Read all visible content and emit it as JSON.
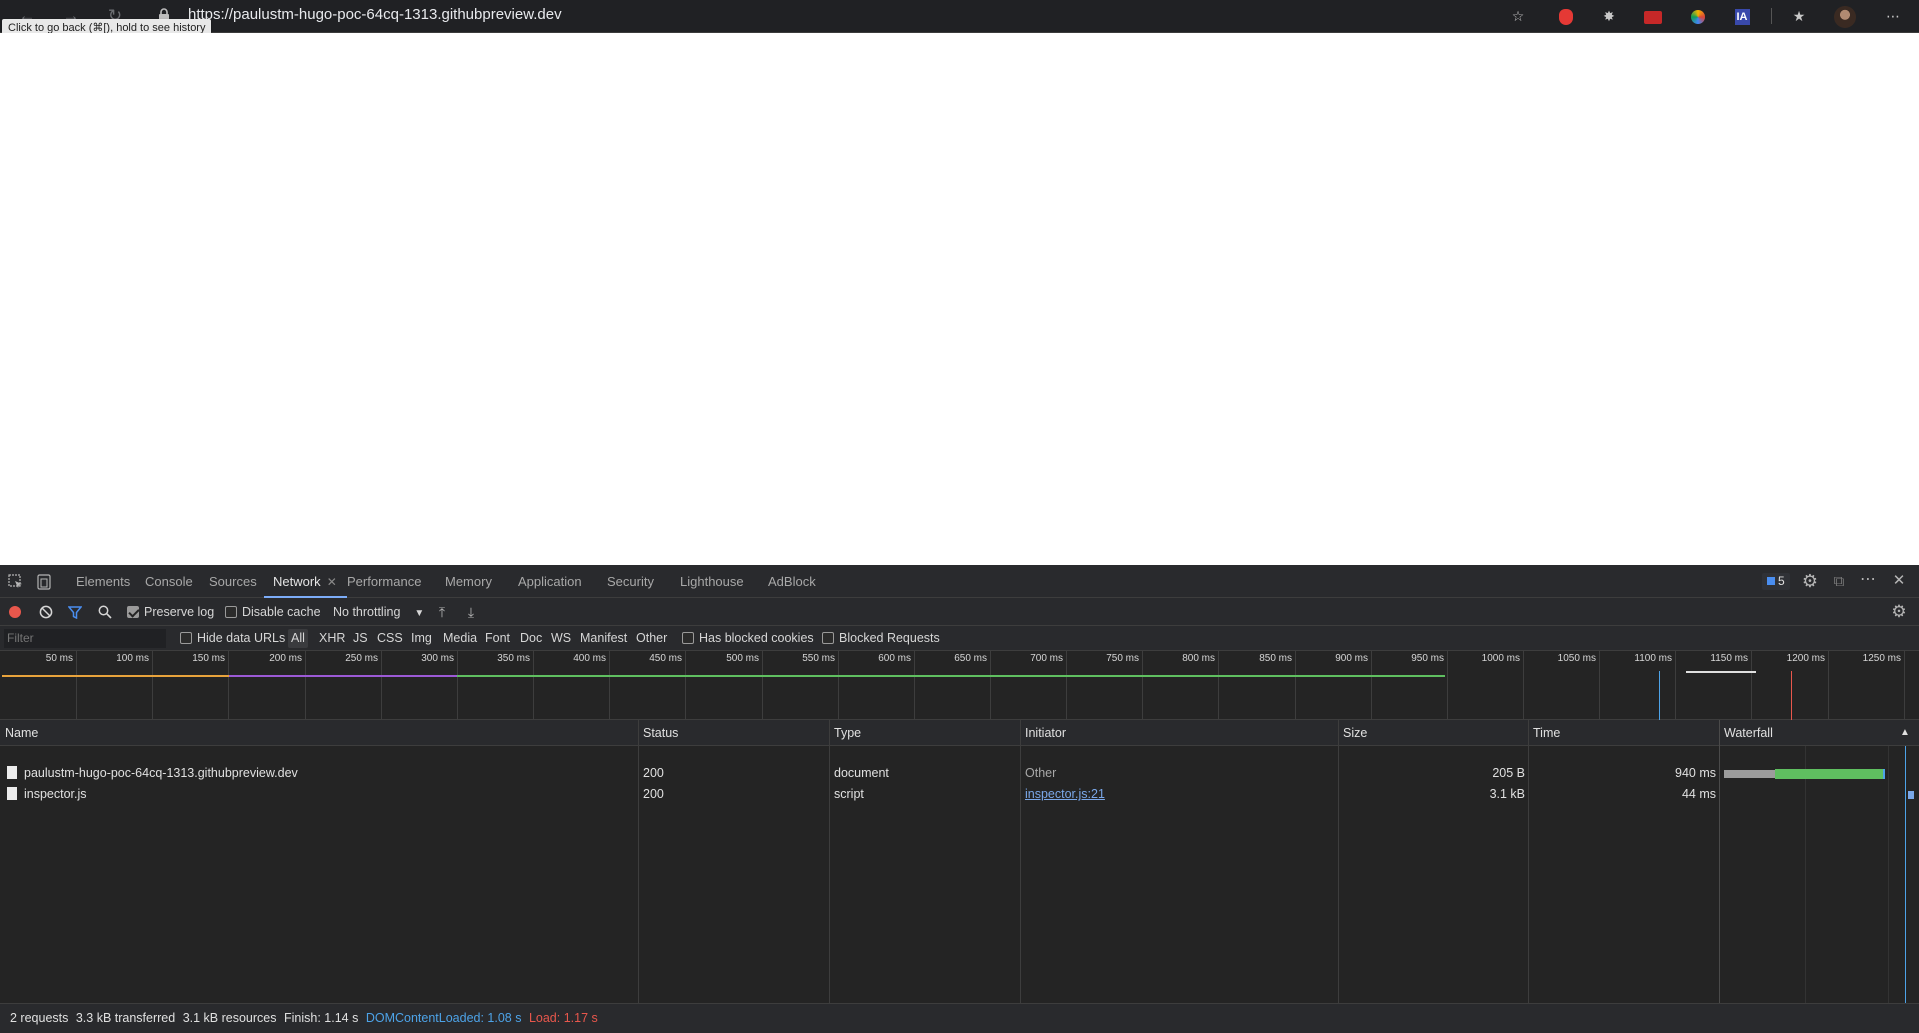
{
  "browser": {
    "url": "https://paulustm-hugo-poc-64cq-1313.githubpreview.dev",
    "tooltip": "Click to go back (⌘[), hold to see history",
    "icons": [
      "back-arrow-icon",
      "forward-arrow-icon",
      "reload-icon",
      "lock-icon",
      "star-add-icon",
      "ext-shield-icon",
      "ext-bug-icon",
      "ext-red-icon",
      "ext-color-icon",
      "ext-ia-icon",
      "favorites-icon",
      "profile-avatar",
      "more-menu-icon"
    ],
    "ext_ia_label": "IA"
  },
  "devtools": {
    "tabs": [
      {
        "label": "Elements"
      },
      {
        "label": "Console"
      },
      {
        "label": "Sources"
      },
      {
        "label": "Network"
      },
      {
        "label": "Performance"
      },
      {
        "label": "Memory"
      },
      {
        "label": "Application"
      },
      {
        "label": "Security"
      },
      {
        "label": "Lighthouse"
      },
      {
        "label": "AdBlock"
      }
    ],
    "active_tab": "Network",
    "issues_count": "5",
    "accent": "#7cacf8"
  },
  "network_toolbar": {
    "preserve_log": "Preserve log",
    "disable_cache": "Disable cache",
    "throttling": "No throttling"
  },
  "filter_bar": {
    "placeholder": "Filter",
    "hide_data_urls": "Hide data URLs",
    "types": [
      "All",
      "XHR",
      "JS",
      "CSS",
      "Img",
      "Media",
      "Font",
      "Doc",
      "WS",
      "Manifest",
      "Other"
    ],
    "has_blocked_cookies": "Has blocked cookies",
    "blocked_requests": "Blocked Requests"
  },
  "overview": {
    "ticks": [
      "50 ms",
      "100 ms",
      "150 ms",
      "200 ms",
      "250 ms",
      "300 ms",
      "350 ms",
      "400 ms",
      "450 ms",
      "500 ms",
      "550 ms",
      "600 ms",
      "650 ms",
      "700 ms",
      "750 ms",
      "800 ms",
      "850 ms",
      "900 ms",
      "950 ms",
      "1000 ms",
      "1050 ms",
      "1100 ms",
      "1150 ms",
      "1200 ms",
      "1250 ms"
    ]
  },
  "table": {
    "columns": [
      "Name",
      "Status",
      "Type",
      "Initiator",
      "Size",
      "Time",
      "Waterfall"
    ],
    "rows": [
      {
        "name": "paulustm-hugo-poc-64cq-1313.githubpreview.dev",
        "status": "200",
        "type": "document",
        "initiator": "Other",
        "size": "205 B",
        "time": "940 ms"
      },
      {
        "name": "inspector.js",
        "status": "200",
        "type": "script",
        "initiator": "inspector.js:21",
        "size": "3.1 kB",
        "time": "44 ms"
      }
    ]
  },
  "status_bar": {
    "requests": "2 requests",
    "transferred": "3.3 kB transferred",
    "resources": "3.1 kB resources",
    "finish": "Finish: 1.14 s",
    "dom_content_loaded": "DOMContentLoaded: 1.08 s",
    "load": "Load: 1.17 s",
    "dcl_color": "#4da3e8",
    "load_color": "#e8574c"
  }
}
